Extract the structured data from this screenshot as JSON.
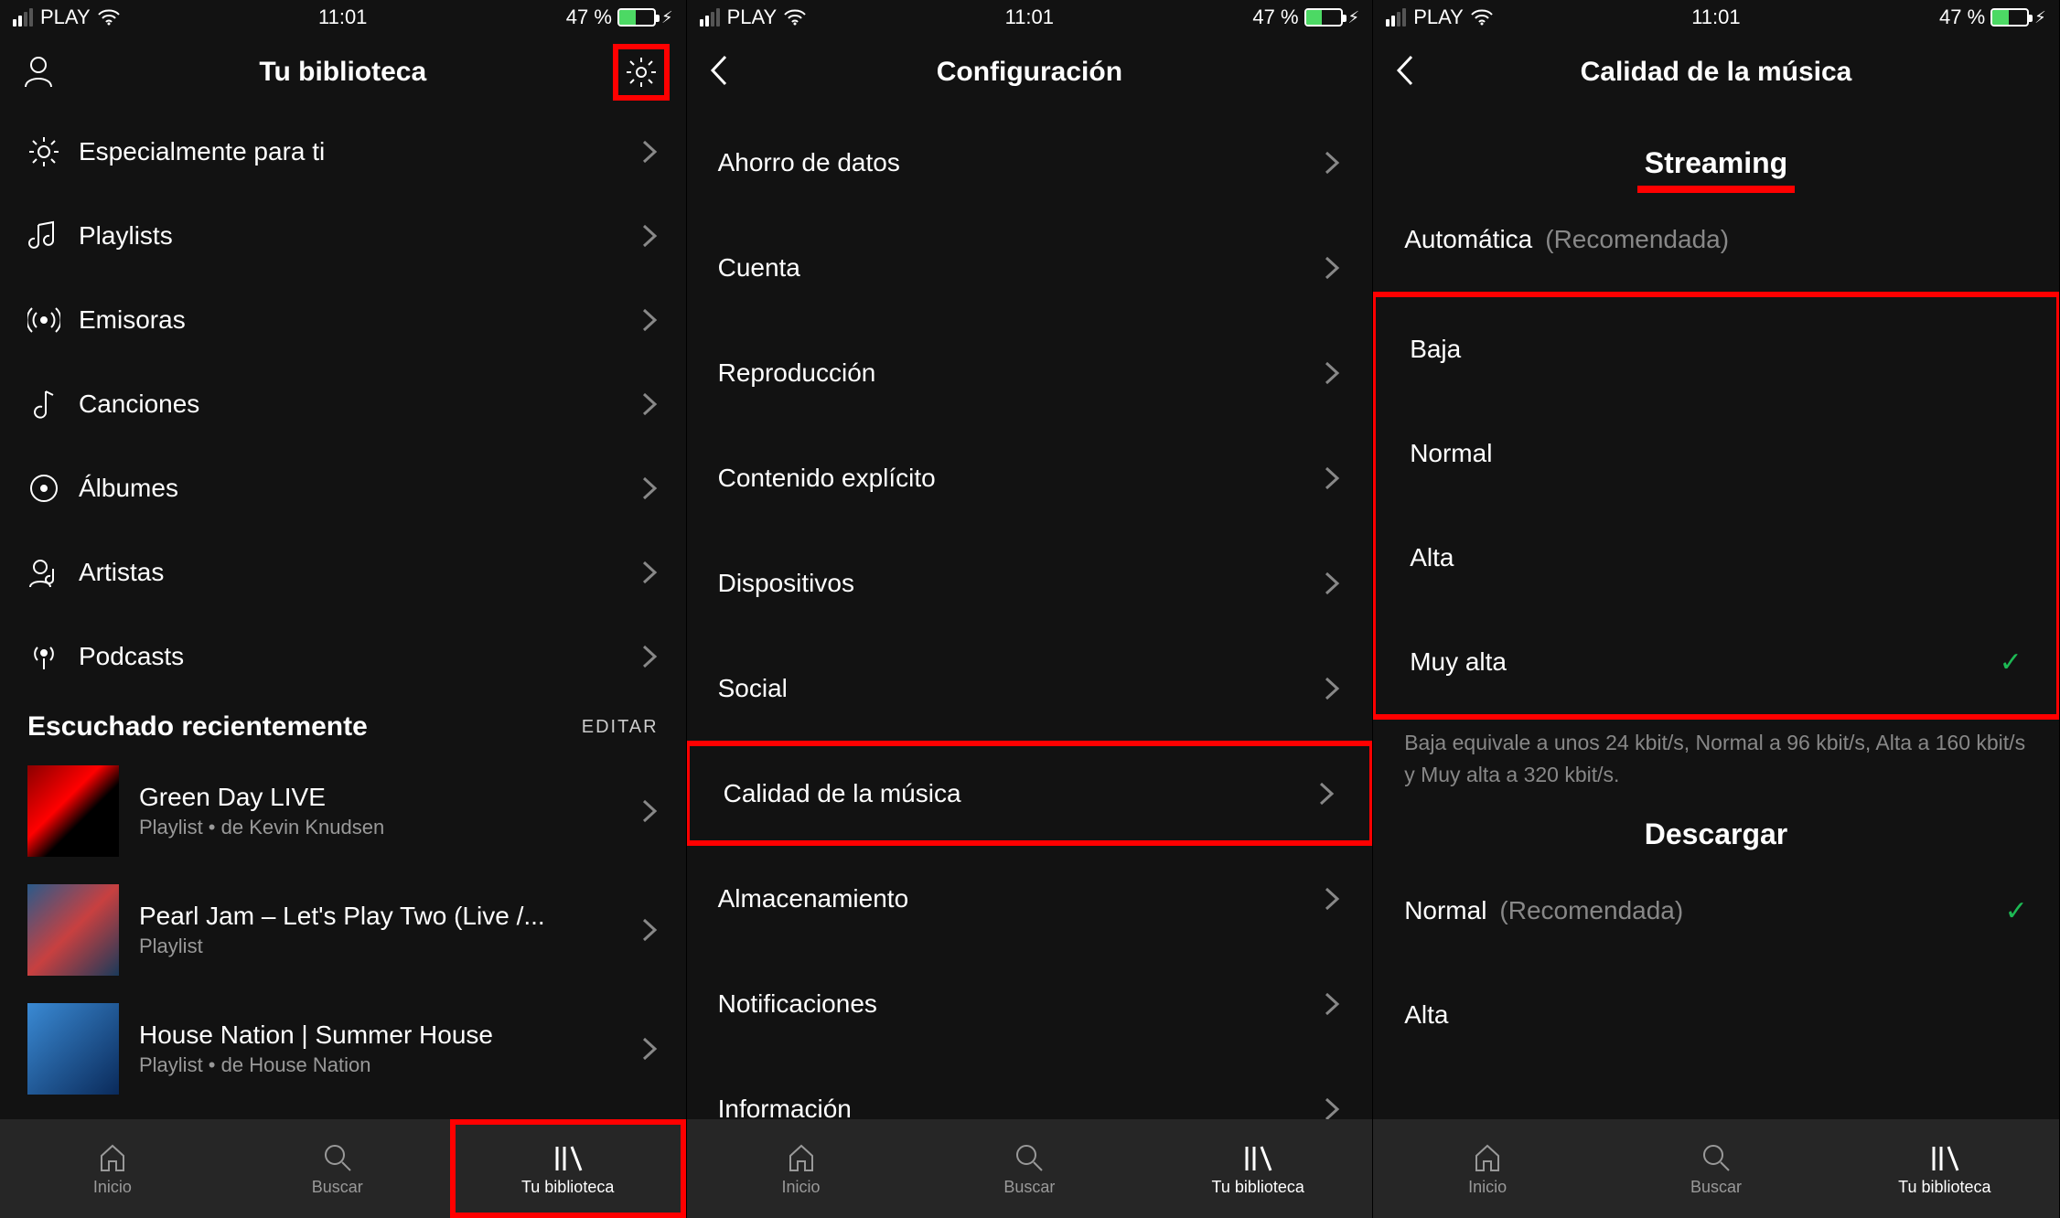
{
  "status": {
    "carrier": "PLAY",
    "time": "11:01",
    "battery_pct": "47 %"
  },
  "screen1": {
    "title": "Tu biblioteca",
    "menu": [
      {
        "label": "Especialmente para ti"
      },
      {
        "label": "Playlists"
      },
      {
        "label": "Emisoras"
      },
      {
        "label": "Canciones"
      },
      {
        "label": "Álbumes"
      },
      {
        "label": "Artistas"
      },
      {
        "label": "Podcasts"
      }
    ],
    "recent_header": "Escuchado recientemente",
    "edit": "EDITAR",
    "recent": [
      {
        "title": "Green Day LIVE",
        "sub": "Playlist • de Kevin Knudsen"
      },
      {
        "title": "Pearl Jam – Let's Play Two (Live /...",
        "sub": "Playlist"
      },
      {
        "title": "House Nation | Summer House",
        "sub": "Playlist • de House Nation"
      }
    ]
  },
  "screen2": {
    "title": "Configuración",
    "items": [
      {
        "label": "Ahorro de datos"
      },
      {
        "label": "Cuenta"
      },
      {
        "label": "Reproducción"
      },
      {
        "label": "Contenido explícito"
      },
      {
        "label": "Dispositivos"
      },
      {
        "label": "Social"
      },
      {
        "label": "Calidad de la música"
      },
      {
        "label": "Almacenamiento"
      },
      {
        "label": "Notificaciones"
      },
      {
        "label": "Información"
      }
    ]
  },
  "screen3": {
    "title": "Calidad de la música",
    "streaming_header": "Streaming",
    "auto": {
      "label": "Automática",
      "hint": "(Recomendada)"
    },
    "options": [
      {
        "label": "Baja"
      },
      {
        "label": "Normal"
      },
      {
        "label": "Alta"
      },
      {
        "label": "Muy alta",
        "checked": true
      }
    ],
    "info": "Baja equivale a unos 24 kbit/s, Normal a 96 kbit/s, Alta a 160 kbit/s y Muy alta a 320 kbit/s.",
    "download_header": "Descargar",
    "download": [
      {
        "label": "Normal",
        "hint": "(Recomendada)",
        "checked": true
      },
      {
        "label": "Alta"
      }
    ]
  },
  "tabs": {
    "home": "Inicio",
    "search": "Buscar",
    "library": "Tu biblioteca"
  }
}
